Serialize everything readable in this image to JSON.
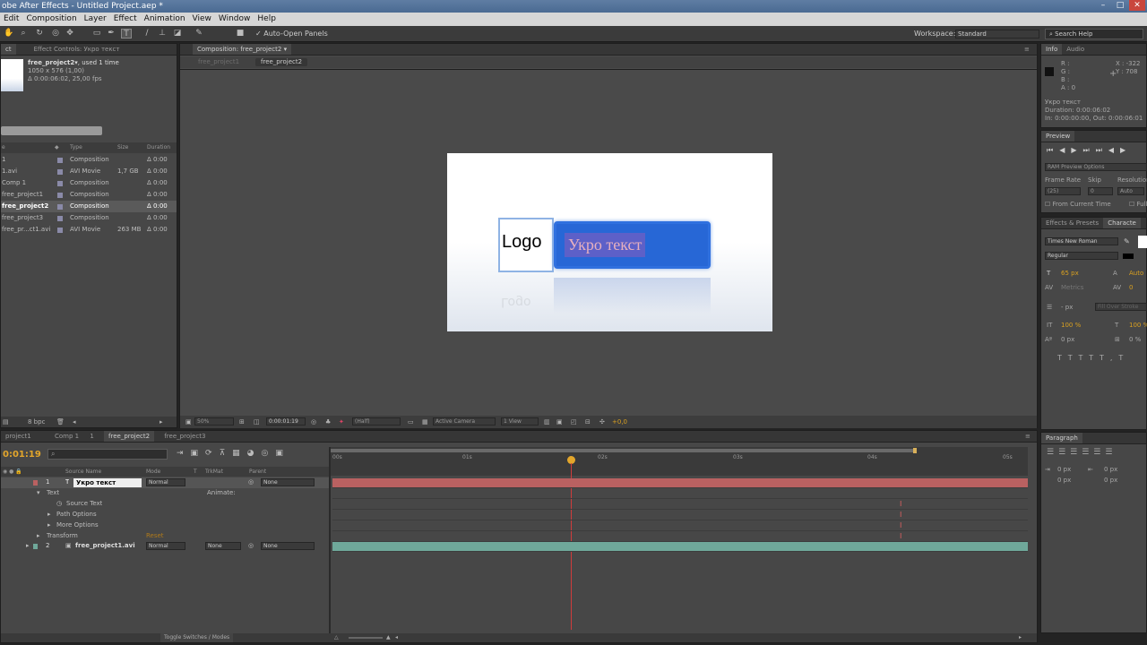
{
  "titlebar": {
    "title": "obe After Effects - Untitled Project.aep *",
    "min": "–",
    "max": "□",
    "close": "✕"
  },
  "menu": [
    "Edit",
    "Composition",
    "Layer",
    "Effect",
    "Animation",
    "View",
    "Window",
    "Help"
  ],
  "toolbar": {
    "auto_open": "Auto-Open Panels",
    "workspace_label": "Workspace:",
    "workspace_value": "Standard",
    "search_placeholder": "Search Help"
  },
  "project": {
    "tabs": [
      "ct",
      "Effect Controls: Укро текст"
    ],
    "item_name": "free_project2▾",
    "item_used": ", used 1 time",
    "item_dims": "1050 x 576 (1,00)",
    "item_dur": "Δ 0:00:06:02, 25,00 fps",
    "columns": [
      "e",
      "Type",
      "Size",
      "Duration"
    ],
    "rows": [
      {
        "name": "1",
        "type": "Composition",
        "size": "",
        "dur": "Δ 0:00",
        "color": "#8a8aa8"
      },
      {
        "name": "1.avi",
        "type": "AVI Movie",
        "size": "1,7 GB",
        "dur": "Δ 0:00",
        "color": "#8a8aa8"
      },
      {
        "name": "Comp 1",
        "type": "Composition",
        "size": "",
        "dur": "Δ 0:00",
        "color": "#8a8aa8"
      },
      {
        "name": "free_project1",
        "type": "Composition",
        "size": "",
        "dur": "Δ 0:00",
        "color": "#8a8aa8"
      },
      {
        "name": "free_project2",
        "type": "Composition",
        "size": "",
        "dur": "Δ 0:00",
        "color": "#8a8aa8"
      },
      {
        "name": "free_project3",
        "type": "Composition",
        "size": "",
        "dur": "Δ 0:00",
        "color": "#8a8aa8"
      },
      {
        "name": "free_pr...ct1.avi",
        "type": "AVI Movie",
        "size": "263 MB",
        "dur": "Δ 0:00",
        "color": "#8a8aa8"
      }
    ],
    "bpc": "8 bpc"
  },
  "comp": {
    "tab": "Composition: free_project2 ▾",
    "crumbs": [
      "free_project1",
      "free_project2"
    ],
    "logo_text": "Logo",
    "caption": "Укро текст",
    "zoom": "50%",
    "timecode": "0:00:01:19",
    "resolution": "(Half)",
    "camera": "Active Camera",
    "view": "1 View",
    "exposure": "+0,0"
  },
  "info": {
    "tabs": [
      "Info",
      "Audio"
    ],
    "r": "R :",
    "g": "G :",
    "b": "B :",
    "a": "A : 0",
    "x": "X : -322",
    "y": "Y : 708",
    "layer": "Укро текст",
    "duration": "Duration: 0:00:06:02",
    "inout": "In: 0:00:00:00, Out: 0:00:06:01"
  },
  "preview": {
    "tab": "Preview",
    "ram": "RAM Preview Options",
    "frame_rate": "Frame Rate",
    "skip": "Skip",
    "resolution": "Resolution",
    "fr_val": "(25)",
    "skip_val": "0",
    "res_val": "Auto",
    "from_current": "From Current Time",
    "full": "Full S"
  },
  "character": {
    "tabs": [
      "Effects & Presets",
      "Characte"
    ],
    "font": "Times New Roman",
    "style": "Regular",
    "size": "65 px",
    "leading": "Auto",
    "kern": "Metrics",
    "track": "0",
    "stroke_w": "- px",
    "stroke_type": "Fill Over Stroke",
    "vscale": "100 %",
    "hscale": "100 %",
    "baseline": "0 px",
    "tsume": "0 %"
  },
  "paragraph": {
    "tab": "Paragraph",
    "indent1": "0 px",
    "indent2": "0 px",
    "indent3": "0 px",
    "space1": "0 px",
    "space2": "0 px"
  },
  "timeline": {
    "tabs": [
      "project1",
      "Comp 1",
      "1",
      "free_project2",
      "free_project3"
    ],
    "timecode": "0:01:19",
    "columns": [
      "Source Name",
      "Mode",
      "T",
      "TrkMat",
      "Parent"
    ],
    "ruler": [
      "00s",
      "01s",
      "02s",
      "03s",
      "04s",
      "05s"
    ],
    "layers": [
      {
        "num": "1",
        "name": "Укро текст",
        "mode": "Normal",
        "trkmat": "",
        "parent": "None"
      },
      {
        "num": "2",
        "name": "free_project1.avi",
        "mode": "Normal",
        "trkmat": "None",
        "parent": "None"
      }
    ],
    "props": {
      "text": "Text",
      "animate": "Animate:",
      "source_text": "Source Text",
      "path_options": "Path Options",
      "more_options": "More Options",
      "transform": "Transform",
      "reset": "Reset"
    },
    "toggle": "Toggle Switches / Modes"
  },
  "colors": {
    "layer1": "#b96161",
    "layer2": "#6fa89a",
    "playhead": "#e05050",
    "accent": "#e3a62b"
  }
}
